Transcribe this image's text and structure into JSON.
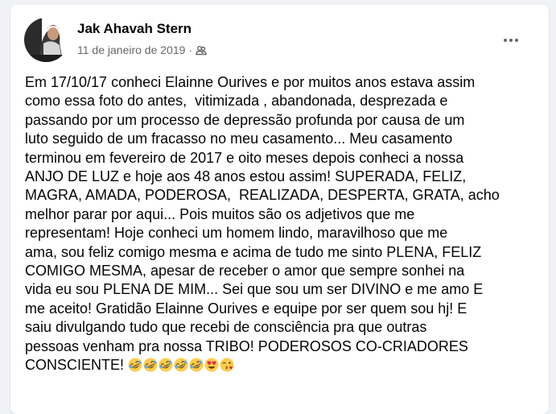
{
  "post": {
    "author": "Jak Ahavah Stern",
    "date": "11 de janeiro de 2019",
    "separator": "·",
    "privacy_icon": "friends-icon",
    "more_icon": "more-options-icon",
    "body": "Em 17/10/17 conheci Elainne Ourives e por muitos anos estava assim\ncomo essa foto do antes,  vitimizada , abandonada, desprezada e\npassando por um processo de depressão profunda por causa de um\nluto seguido de um fracasso no meu casamento... Meu casamento\nterminou em fevereiro de 2017 e oito meses depois conheci a nossa\nANJO DE LUZ e hoje aos 48 anos estou assim! SUPERADA, FELIZ,\nMAGRA, AMADA, PODEROSA,  REALIZADA, DESPERTA, GRATA, acho\nmelhor parar por aqui... Pois muitos são os adjetivos que me\nrepresentam! Hoje conheci um homem lindo, maravilhoso que me\nama, sou feliz comigo mesma e acima de tudo me sinto PLENA, FELIZ\nCOMIGO MESMA, apesar de receber o amor que sempre sonhei na\nvida eu sou PLENA DE MIM... Sei que sou um ser DIVINO e me amo E\nme aceito! Gratidão Elainne Ourives e equipe por ser quem sou hj! E\nsaiu divulgando tudo que recebi de consciência pra que outras\npessoas venham pra nossa TRIBO! PODEROSOS CO-CRIADORES\nCONSCIENTE! ",
    "emojis": [
      "🤣",
      "🤣",
      "🤣",
      "🤣",
      "🤣",
      "😍",
      "😘"
    ],
    "emoji_icons": [
      "rofl-emoji",
      "rofl-emoji",
      "rofl-emoji",
      "rofl-emoji",
      "rofl-emoji",
      "heart-eyes-emoji",
      "kiss-emoji"
    ]
  },
  "colors": {
    "page_background": "#f0f2f5",
    "card_background": "#ffffff",
    "primary_text": "#050505",
    "secondary_text": "#65676b",
    "emoji_yellow": "#ffcc4d"
  }
}
